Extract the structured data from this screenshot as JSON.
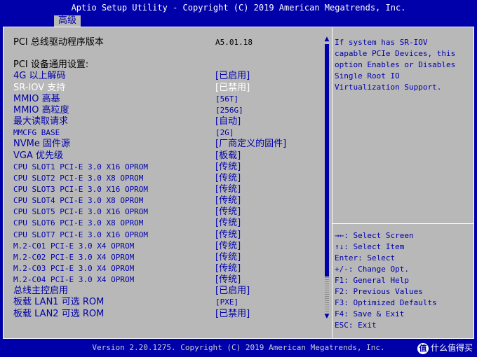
{
  "title": "Aptio Setup Utility - Copyright (C) 2019 American Megatrends, Inc.",
  "tab": "高级",
  "rows": [
    {
      "label": "PCI 总线驱动程序版本",
      "value": "A5.01.18",
      "kind": "static"
    },
    {
      "label": "",
      "value": "",
      "kind": "static"
    },
    {
      "label": "PCI 设备通用设置:",
      "value": "",
      "kind": "static"
    },
    {
      "label": "4G 以上解码",
      "value": "[已启用]",
      "kind": "item"
    },
    {
      "label": "SR-IOV 支持",
      "value": "[已禁用]",
      "kind": "selected"
    },
    {
      "label": "MMIO 高基",
      "value": "[56T]",
      "kind": "item"
    },
    {
      "label": "MMIO 高粒度",
      "value": "[256G]",
      "kind": "item"
    },
    {
      "label": "最大读取请求",
      "value": "[自动]",
      "kind": "item"
    },
    {
      "label": "MMCFG BASE",
      "value": "[2G]",
      "kind": "item"
    },
    {
      "label": "NVMe 固件源",
      "value": "[厂商定义的固件]",
      "kind": "item"
    },
    {
      "label": "VGA 优先级",
      "value": "[板载]",
      "kind": "item"
    },
    {
      "label": "CPU SLOT1 PCI-E 3.0 X16 OPROM",
      "value": "[传统]",
      "kind": "item"
    },
    {
      "label": "CPU SLOT2 PCI-E 3.0 X8 OPROM",
      "value": "[传统]",
      "kind": "item"
    },
    {
      "label": "CPU SLOT3 PCI-E 3.0 X16 OPROM",
      "value": "[传统]",
      "kind": "item"
    },
    {
      "label": "CPU SLOT4 PCI-E 3.0 X8 OPROM",
      "value": "[传统]",
      "kind": "item"
    },
    {
      "label": "CPU SLOT5 PCI-E 3.0 X16 OPROM",
      "value": "[传统]",
      "kind": "item"
    },
    {
      "label": "CPU SLOT6 PCI-E 3.0 X8 OPROM",
      "value": "[传统]",
      "kind": "item"
    },
    {
      "label": "CPU SLOT7 PCI-E 3.0 X16 OPROM",
      "value": "[传统]",
      "kind": "item"
    },
    {
      "label": "M.2-C01 PCI-E 3.0 X4 OPROM",
      "value": "[传统]",
      "kind": "item"
    },
    {
      "label": "M.2-C02 PCI-E 3.0 X4 OPROM",
      "value": "[传统]",
      "kind": "item"
    },
    {
      "label": "M.2-C03 PCI-E 3.0 X4 OPROM",
      "value": "[传统]",
      "kind": "item"
    },
    {
      "label": "M.2-C04 PCI-E 3.0 X4 OPROM",
      "value": "[传统]",
      "kind": "item"
    },
    {
      "label": "总线主控启用",
      "value": "[已启用]",
      "kind": "item"
    },
    {
      "label": "板载 LAN1 可选 ROM",
      "value": "[PXE]",
      "kind": "item"
    },
    {
      "label": "板载 LAN2 可选 ROM",
      "value": "[已禁用]",
      "kind": "item"
    }
  ],
  "help_text": "If system has SR-IOV\ncapable PCIe Devices, this\noption Enables or Disables\nSingle Root IO\nVirtualization Support.",
  "keys": [
    "→←: Select Screen",
    "↑↓: Select Item",
    "Enter: Select",
    "+/-: Change Opt.",
    "F1: General Help",
    "F2: Previous Values",
    "F3: Optimized Defaults",
    "F4: Save & Exit",
    "ESC: Exit"
  ],
  "footer": "Version 2.20.1275. Copyright (C) 2019 American Megatrends, Inc.",
  "watermark": "值 什么值得买",
  "scroll_up_glyph": "▲",
  "scroll_down_glyph": "▼",
  "colors": {
    "background": "#0000aa",
    "panel": "#b8b8b8",
    "selected_text": "#ffffff",
    "item_text": "#0000aa"
  }
}
